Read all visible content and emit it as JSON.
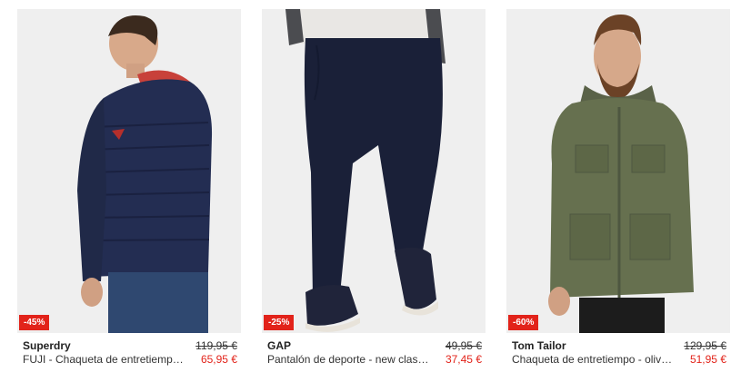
{
  "products": [
    {
      "discount": "-45%",
      "brand": "Superdry",
      "name": "FUJI - Chaqueta de entretiempo - navy",
      "old_price": "119,95 €",
      "price": "65,95 €"
    },
    {
      "discount": "-25%",
      "brand": "GAP",
      "name": "Pantalón de deporte - new classic navy",
      "old_price": "49,95 €",
      "price": "37,45 €"
    },
    {
      "discount": "-60%",
      "brand": "Tom Tailor",
      "name": "Chaqueta de entretiempo - olive green",
      "old_price": "129,95 €",
      "price": "51,95 €"
    }
  ],
  "colors": {
    "accent": "#e2231a",
    "photo_background": "#efefef"
  }
}
